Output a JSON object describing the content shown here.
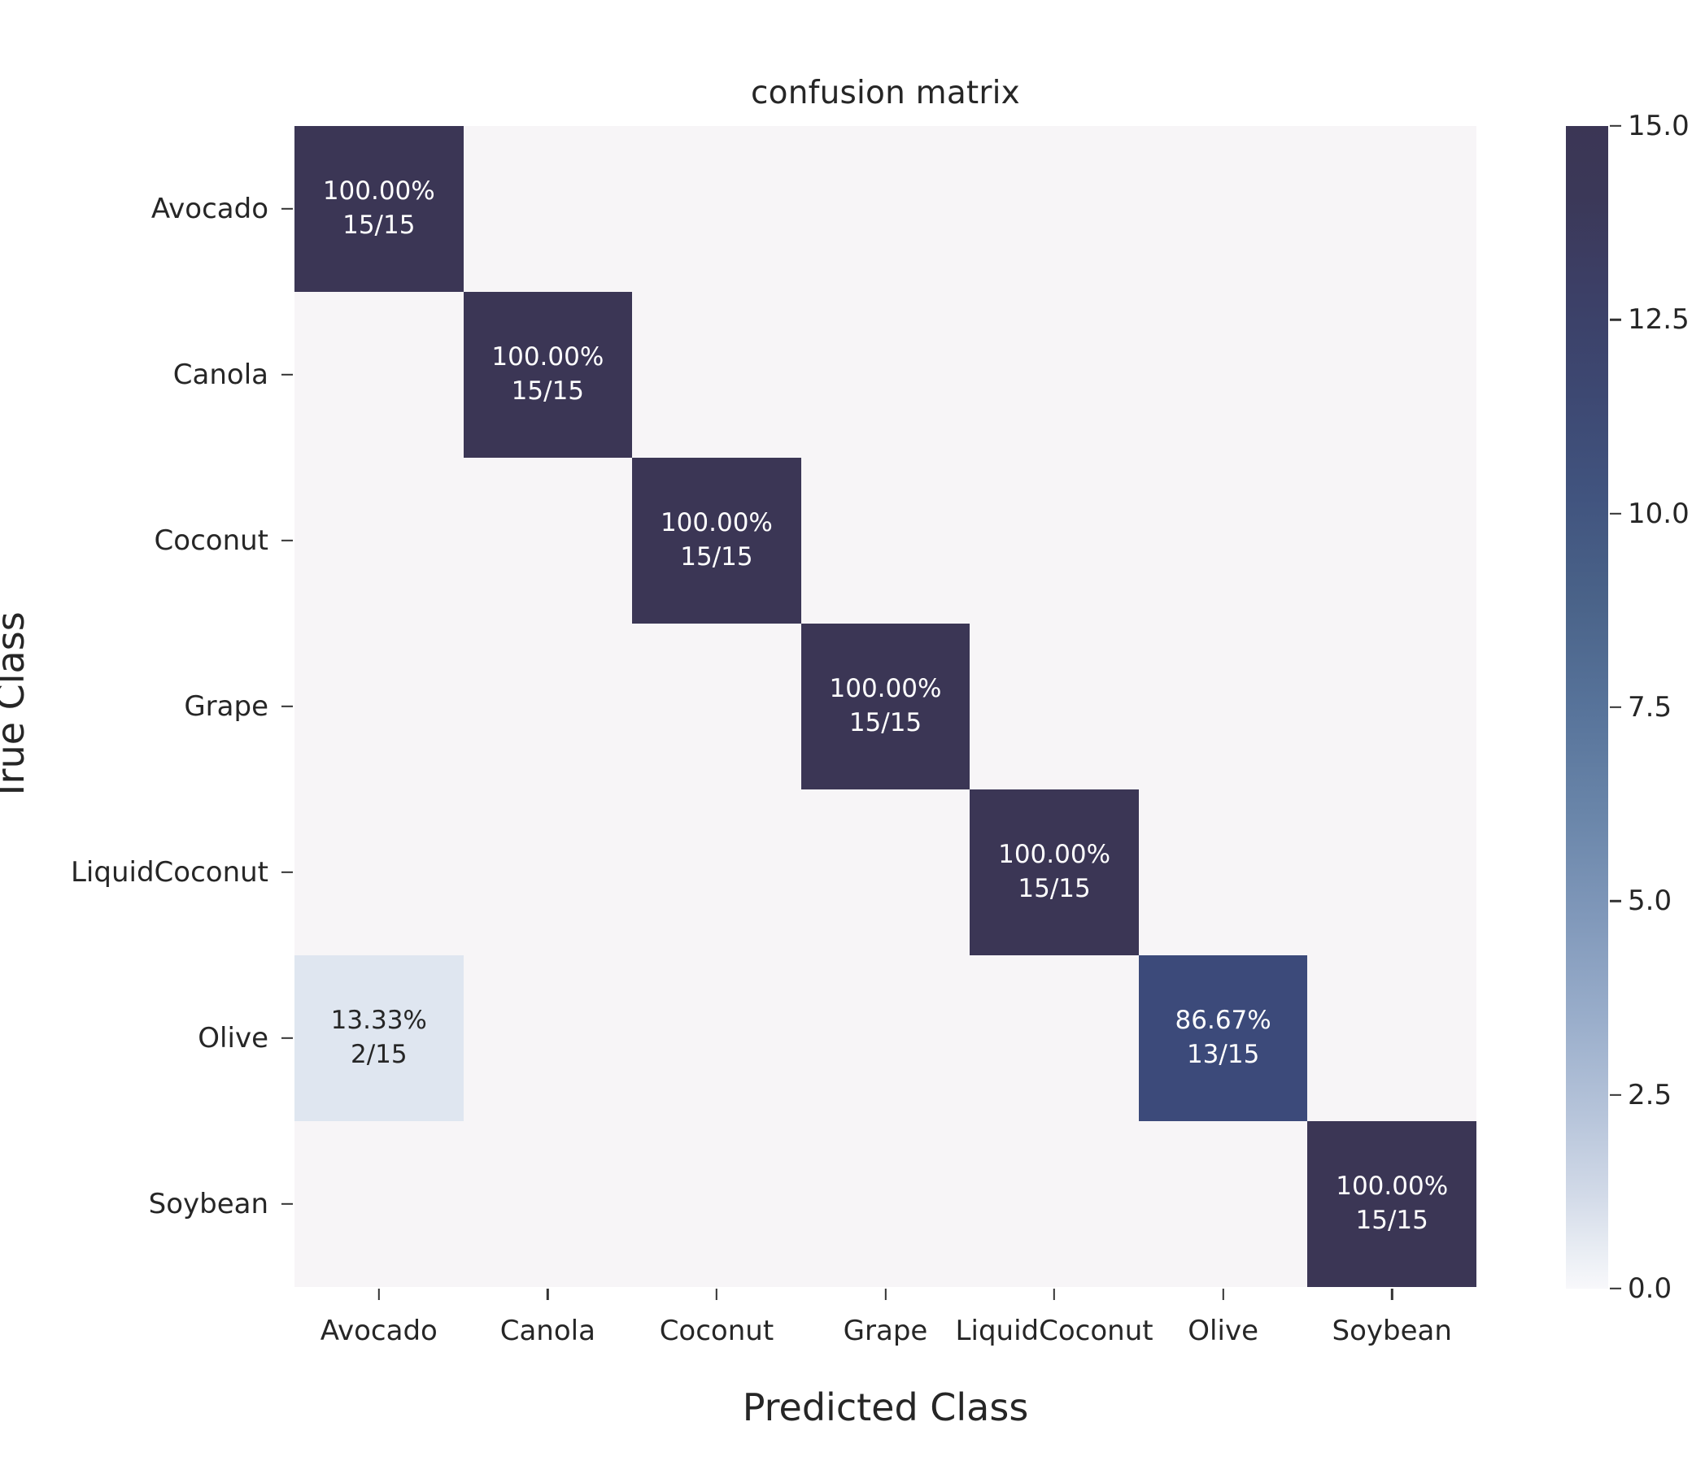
{
  "chart_data": {
    "type": "heatmap",
    "title": "confusion matrix",
    "xlabel": "Predicted Class",
    "ylabel": "True Class",
    "categories": [
      "Avocado",
      "Canola",
      "Coconut",
      "Grape",
      "LiquidCoconut",
      "Olive",
      "Soybean"
    ],
    "x_tick_labels": [
      "Avocado",
      "Canola",
      "Coconut",
      "Grape",
      "LiquidCoconut",
      "Olive",
      "Soybean"
    ],
    "y_tick_labels": [
      "Avocado",
      "Canola",
      "Coconut",
      "Grape",
      "LiquidCoconut",
      "Olive",
      "Soybean"
    ],
    "colorbar": {
      "ticks": [
        "15.0",
        "12.5",
        "10.0",
        "7.5",
        "5.0",
        "2.5",
        "0.0"
      ],
      "tick_values": [
        15.0,
        12.5,
        10.0,
        7.5,
        5.0,
        2.5,
        0.0
      ],
      "vmin": 0,
      "vmax": 15,
      "cmap_dark": "#3b3655",
      "cmap_light": "#f8f8fb"
    },
    "grid": false,
    "legend_position": "right-colorbar",
    "row_total": 15,
    "values": [
      [
        15,
        0,
        0,
        0,
        0,
        0,
        0
      ],
      [
        0,
        15,
        0,
        0,
        0,
        0,
        0
      ],
      [
        0,
        0,
        15,
        0,
        0,
        0,
        0
      ],
      [
        0,
        0,
        0,
        15,
        0,
        0,
        0
      ],
      [
        0,
        0,
        0,
        0,
        15,
        0,
        0
      ],
      [
        2,
        0,
        0,
        0,
        0,
        13,
        0
      ],
      [
        0,
        0,
        0,
        0,
        0,
        0,
        15
      ]
    ],
    "percent_values": [
      [
        100.0,
        0,
        0,
        0,
        0,
        0,
        0
      ],
      [
        0,
        100.0,
        0,
        0,
        0,
        0,
        0
      ],
      [
        0,
        0,
        100.0,
        0,
        0,
        0,
        0
      ],
      [
        0,
        0,
        0,
        100.0,
        0,
        0,
        0
      ],
      [
        0,
        0,
        0,
        0,
        100.0,
        0,
        0
      ],
      [
        13.33,
        0,
        0,
        0,
        0,
        86.67,
        0
      ],
      [
        0,
        0,
        0,
        0,
        0,
        0,
        100.0
      ]
    ],
    "cells": [
      [
        {
          "pct": "100.00%",
          "frac": "15/15",
          "bg": "#3b3655",
          "fg": "#ffffff",
          "filled": true
        },
        {
          "pct": "",
          "frac": "",
          "bg": "#f7f5f7",
          "fg": "#262626",
          "filled": false
        },
        {
          "pct": "",
          "frac": "",
          "bg": "#f7f5f7",
          "fg": "#262626",
          "filled": false
        },
        {
          "pct": "",
          "frac": "",
          "bg": "#f7f5f7",
          "fg": "#262626",
          "filled": false
        },
        {
          "pct": "",
          "frac": "",
          "bg": "#f7f5f7",
          "fg": "#262626",
          "filled": false
        },
        {
          "pct": "",
          "frac": "",
          "bg": "#f7f5f7",
          "fg": "#262626",
          "filled": false
        },
        {
          "pct": "",
          "frac": "",
          "bg": "#f7f5f7",
          "fg": "#262626",
          "filled": false
        }
      ],
      [
        {
          "pct": "",
          "frac": "",
          "bg": "#f7f5f7",
          "fg": "#262626",
          "filled": false
        },
        {
          "pct": "100.00%",
          "frac": "15/15",
          "bg": "#3b3655",
          "fg": "#ffffff",
          "filled": true
        },
        {
          "pct": "",
          "frac": "",
          "bg": "#f7f5f7",
          "fg": "#262626",
          "filled": false
        },
        {
          "pct": "",
          "frac": "",
          "bg": "#f7f5f7",
          "fg": "#262626",
          "filled": false
        },
        {
          "pct": "",
          "frac": "",
          "bg": "#f7f5f7",
          "fg": "#262626",
          "filled": false
        },
        {
          "pct": "",
          "frac": "",
          "bg": "#f7f5f7",
          "fg": "#262626",
          "filled": false
        },
        {
          "pct": "",
          "frac": "",
          "bg": "#f7f5f7",
          "fg": "#262626",
          "filled": false
        }
      ],
      [
        {
          "pct": "",
          "frac": "",
          "bg": "#f7f5f7",
          "fg": "#262626",
          "filled": false
        },
        {
          "pct": "",
          "frac": "",
          "bg": "#f7f5f7",
          "fg": "#262626",
          "filled": false
        },
        {
          "pct": "100.00%",
          "frac": "15/15",
          "bg": "#3b3655",
          "fg": "#ffffff",
          "filled": true
        },
        {
          "pct": "",
          "frac": "",
          "bg": "#f7f5f7",
          "fg": "#262626",
          "filled": false
        },
        {
          "pct": "",
          "frac": "",
          "bg": "#f7f5f7",
          "fg": "#262626",
          "filled": false
        },
        {
          "pct": "",
          "frac": "",
          "bg": "#f7f5f7",
          "fg": "#262626",
          "filled": false
        },
        {
          "pct": "",
          "frac": "",
          "bg": "#f7f5f7",
          "fg": "#262626",
          "filled": false
        }
      ],
      [
        {
          "pct": "",
          "frac": "",
          "bg": "#f7f5f7",
          "fg": "#262626",
          "filled": false
        },
        {
          "pct": "",
          "frac": "",
          "bg": "#f7f5f7",
          "fg": "#262626",
          "filled": false
        },
        {
          "pct": "",
          "frac": "",
          "bg": "#f7f5f7",
          "fg": "#262626",
          "filled": false
        },
        {
          "pct": "100.00%",
          "frac": "15/15",
          "bg": "#3b3655",
          "fg": "#ffffff",
          "filled": true
        },
        {
          "pct": "",
          "frac": "",
          "bg": "#f7f5f7",
          "fg": "#262626",
          "filled": false
        },
        {
          "pct": "",
          "frac": "",
          "bg": "#f7f5f7",
          "fg": "#262626",
          "filled": false
        },
        {
          "pct": "",
          "frac": "",
          "bg": "#f7f5f7",
          "fg": "#262626",
          "filled": false
        }
      ],
      [
        {
          "pct": "",
          "frac": "",
          "bg": "#f7f5f7",
          "fg": "#262626",
          "filled": false
        },
        {
          "pct": "",
          "frac": "",
          "bg": "#f7f5f7",
          "fg": "#262626",
          "filled": false
        },
        {
          "pct": "",
          "frac": "",
          "bg": "#f7f5f7",
          "fg": "#262626",
          "filled": false
        },
        {
          "pct": "",
          "frac": "",
          "bg": "#f7f5f7",
          "fg": "#262626",
          "filled": false
        },
        {
          "pct": "100.00%",
          "frac": "15/15",
          "bg": "#3b3655",
          "fg": "#ffffff",
          "filled": true
        },
        {
          "pct": "",
          "frac": "",
          "bg": "#f7f5f7",
          "fg": "#262626",
          "filled": false
        },
        {
          "pct": "",
          "frac": "",
          "bg": "#f7f5f7",
          "fg": "#262626",
          "filled": false
        }
      ],
      [
        {
          "pct": "13.33%",
          "frac": "2/15",
          "bg": "#dfe6f0",
          "fg": "#262626",
          "filled": true
        },
        {
          "pct": "",
          "frac": "",
          "bg": "#f7f5f7",
          "fg": "#262626",
          "filled": false
        },
        {
          "pct": "",
          "frac": "",
          "bg": "#f7f5f7",
          "fg": "#262626",
          "filled": false
        },
        {
          "pct": "",
          "frac": "",
          "bg": "#f7f5f7",
          "fg": "#262626",
          "filled": false
        },
        {
          "pct": "",
          "frac": "",
          "bg": "#f7f5f7",
          "fg": "#262626",
          "filled": false
        },
        {
          "pct": "86.67%",
          "frac": "13/15",
          "bg": "#3c4a7a",
          "fg": "#ffffff",
          "filled": true
        },
        {
          "pct": "",
          "frac": "",
          "bg": "#f7f5f7",
          "fg": "#262626",
          "filled": false
        }
      ],
      [
        {
          "pct": "",
          "frac": "",
          "bg": "#f7f5f7",
          "fg": "#262626",
          "filled": false
        },
        {
          "pct": "",
          "frac": "",
          "bg": "#f7f5f7",
          "fg": "#262626",
          "filled": false
        },
        {
          "pct": "",
          "frac": "",
          "bg": "#f7f5f7",
          "fg": "#262626",
          "filled": false
        },
        {
          "pct": "",
          "frac": "",
          "bg": "#f7f5f7",
          "fg": "#262626",
          "filled": false
        },
        {
          "pct": "",
          "frac": "",
          "bg": "#f7f5f7",
          "fg": "#262626",
          "filled": false
        },
        {
          "pct": "",
          "frac": "",
          "bg": "#f7f5f7",
          "fg": "#262626",
          "filled": false
        },
        {
          "pct": "100.00%",
          "frac": "15/15",
          "bg": "#3b3655",
          "fg": "#ffffff",
          "filled": true
        }
      ]
    ]
  }
}
